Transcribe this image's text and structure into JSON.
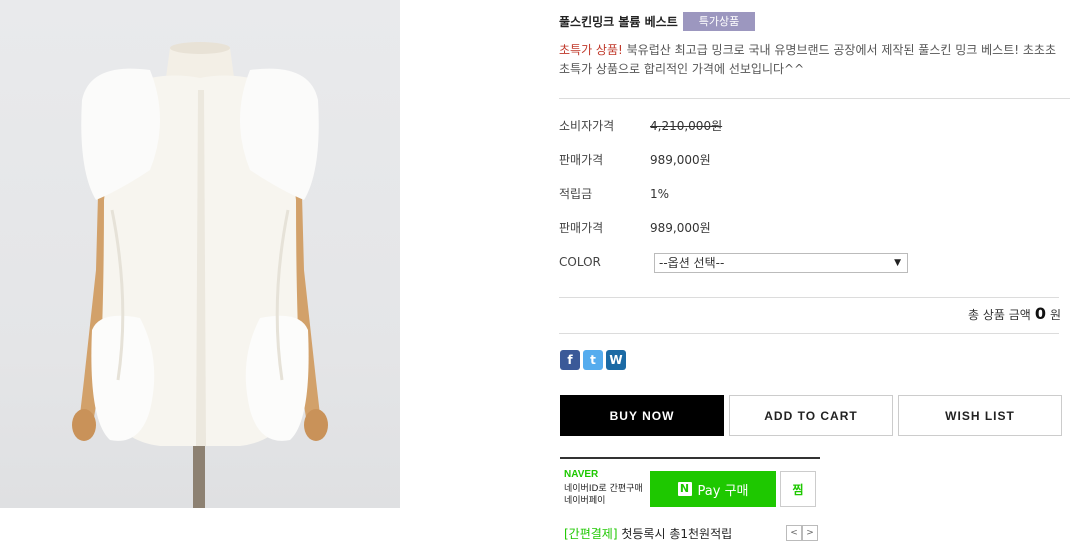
{
  "product": {
    "name": "풀스킨밍크 볼륨 베스트",
    "badge": "특가상품",
    "desc_highlight": "초특가 상품!",
    "desc_line1": " 북유럽산 최고급 밍크로 국내 유명브랜드 공장에서 제작된 풀스킨 밍크 베스트! 초초초",
    "desc_line2": "초특가 상품으로 합리적인 가격에 선보입니다^^"
  },
  "prices": {
    "consumer_label": "소비자가격",
    "consumer_value": "4,210,000원",
    "sale_label": "판매가격",
    "sale_value": "989,000원",
    "points_label": "적립금",
    "points_value": "1%",
    "sale2_label": "판매가격",
    "sale2_value": "989,000원"
  },
  "option": {
    "label": "COLOR",
    "selected": "--옵션 선택--"
  },
  "total": {
    "label": "총 상품 금액",
    "amount": "0",
    "unit": "원"
  },
  "share": {
    "facebook": "f",
    "twitter": "t",
    "other": "W"
  },
  "actions": {
    "buy_now": "BUY NOW",
    "add_to_cart": "ADD TO CART",
    "wish_list": "WISH LIST"
  },
  "npay": {
    "logo": "NAVER",
    "desc": "네이버ID로 간편구매 네이버페이",
    "pay_n": "N",
    "pay_label": "Pay 구매",
    "zzim": "찜",
    "promo_tag": "[간편결제]",
    "promo_text": " 첫등록시 총1천원적립",
    "prev": "<",
    "next": ">"
  },
  "colors": {
    "badge": "#9c97bf",
    "highlight": "#c0392b",
    "npay_green": "#1ec800",
    "buy_button": "#000000"
  }
}
